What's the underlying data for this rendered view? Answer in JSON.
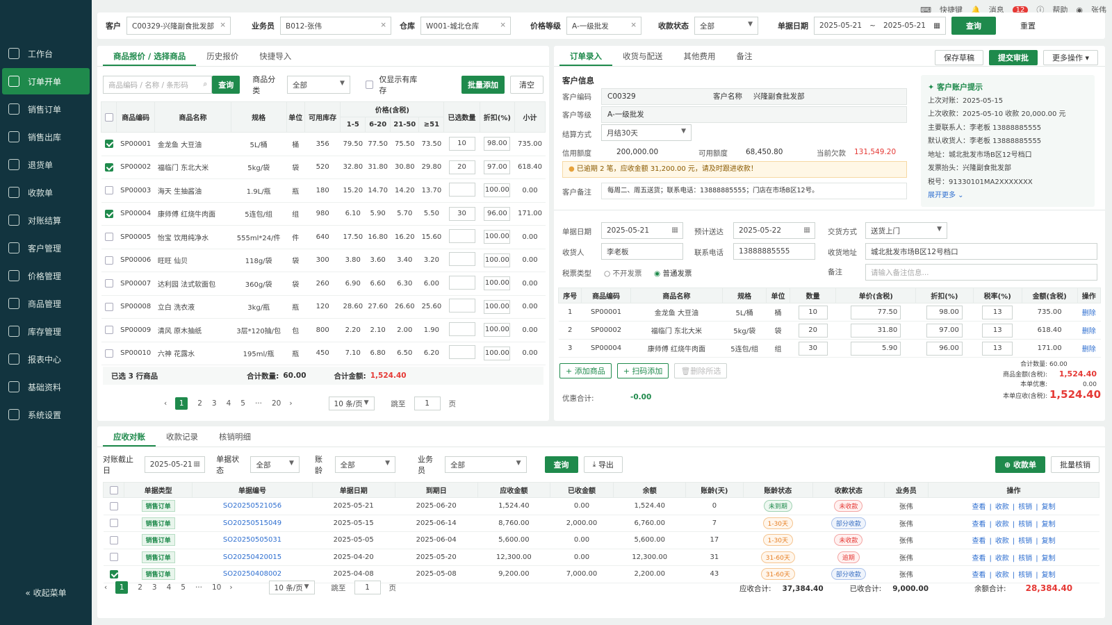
{
  "sidebar": {
    "items": [
      {
        "label": "工作台",
        "icon": "home-icon"
      },
      {
        "label": "订单开单",
        "icon": "order-icon"
      },
      {
        "label": "销售订单",
        "icon": "document-icon"
      },
      {
        "label": "销售出库",
        "icon": "outbound-icon"
      },
      {
        "label": "退货单",
        "icon": "return-icon"
      },
      {
        "label": "收款单",
        "icon": "coin-icon"
      },
      {
        "label": "对账结算",
        "icon": "reconcile-icon"
      },
      {
        "label": "客户管理",
        "icon": "user-icon"
      },
      {
        "label": "价格管理",
        "icon": "price-icon"
      },
      {
        "label": "商品管理",
        "icon": "goods-icon"
      },
      {
        "label": "库存管理",
        "icon": "warehouse-icon"
      },
      {
        "label": "报表中心",
        "icon": "chart-icon"
      },
      {
        "label": "基础资料",
        "icon": "database-icon"
      },
      {
        "label": "系统设置",
        "icon": "gear-icon"
      }
    ],
    "active": 1,
    "collapse": "收起菜单"
  },
  "topbar": {
    "shortcut": "快捷键",
    "message": "消息",
    "badge": "12",
    "help": "帮助",
    "user": "张伟"
  },
  "filters": {
    "customer_label": "客户",
    "customer": "C00329-兴隆副食批发部",
    "sales_label": "业务员",
    "sales": "B012-张伟",
    "wh_label": "仓库",
    "wh": "W001-城北仓库",
    "price_label": "价格等级",
    "price": "A-一级批发",
    "pay_label": "收款状态",
    "pay": "全部",
    "date_label": "单据日期",
    "date_from": "2025-05-21",
    "date_sep": "~",
    "date_to": "2025-05-21",
    "query": "查询",
    "reset": "重置"
  },
  "goods": {
    "tabs": [
      "商品报价 / 选择商品",
      "历史报价",
      "快捷导入"
    ],
    "search_placeholder": "商品编码 / 名称 / 条形码",
    "search_btn": "查询",
    "cat_label": "商品分类",
    "cat": "全部",
    "stock_only": "仅显示有库存",
    "batch_add": "批量添加",
    "clear": "清空",
    "headers": {
      "code": "商品编码",
      "name": "商品名称",
      "spec": "规格",
      "unit": "单位",
      "stock": "可用库存",
      "price_group": "价格(含税)",
      "p1": "1-5",
      "p2": "6-20",
      "p3": "21-50",
      "p4": "≥51",
      "qty": "已选数量",
      "disc": "折扣(%)",
      "sub": "小计"
    },
    "rows": [
      {
        "checked": true,
        "code": "SP00001",
        "name": "金龙鱼 大豆油",
        "spec": "5L/桶",
        "unit": "桶",
        "stock": "356",
        "p1": "79.50",
        "p2": "77.50",
        "p3": "75.50",
        "p4": "73.50",
        "qty": "10",
        "disc": "98.00",
        "sub": "735.00"
      },
      {
        "checked": true,
        "code": "SP00002",
        "name": "福临门 东北大米",
        "spec": "5kg/袋",
        "unit": "袋",
        "stock": "520",
        "p1": "32.80",
        "p2": "31.80",
        "p3": "30.80",
        "p4": "29.80",
        "qty": "20",
        "disc": "97.00",
        "sub": "618.40"
      },
      {
        "checked": false,
        "code": "SP00003",
        "name": "海天 生抽酱油",
        "spec": "1.9L/瓶",
        "unit": "瓶",
        "stock": "180",
        "p1": "15.20",
        "p2": "14.70",
        "p3": "14.20",
        "p4": "13.70",
        "qty": "",
        "disc": "100.00",
        "sub": "0.00"
      },
      {
        "checked": true,
        "code": "SP00004",
        "name": "康师傅 红烧牛肉面",
        "spec": "5连包/组",
        "unit": "组",
        "stock": "980",
        "p1": "6.10",
        "p2": "5.90",
        "p3": "5.70",
        "p4": "5.50",
        "qty": "30",
        "disc": "96.00",
        "sub": "171.00"
      },
      {
        "checked": false,
        "code": "SP00005",
        "name": "怡宝 饮用纯净水",
        "spec": "555ml*24/件",
        "unit": "件",
        "stock": "640",
        "p1": "17.50",
        "p2": "16.80",
        "p3": "16.20",
        "p4": "15.60",
        "qty": "",
        "disc": "100.00",
        "sub": "0.00"
      },
      {
        "checked": false,
        "code": "SP00006",
        "name": "旺旺 仙贝",
        "spec": "118g/袋",
        "unit": "袋",
        "stock": "300",
        "p1": "3.80",
        "p2": "3.60",
        "p3": "3.40",
        "p4": "3.20",
        "qty": "",
        "disc": "100.00",
        "sub": "0.00"
      },
      {
        "checked": false,
        "code": "SP00007",
        "name": "达利园 法式软面包",
        "spec": "360g/袋",
        "unit": "袋",
        "stock": "260",
        "p1": "6.90",
        "p2": "6.60",
        "p3": "6.30",
        "p4": "6.00",
        "qty": "",
        "disc": "100.00",
        "sub": "0.00"
      },
      {
        "checked": false,
        "code": "SP00008",
        "name": "立白 洗衣液",
        "spec": "3kg/瓶",
        "unit": "瓶",
        "stock": "120",
        "p1": "28.60",
        "p2": "27.60",
        "p3": "26.60",
        "p4": "25.60",
        "qty": "",
        "disc": "100.00",
        "sub": "0.00"
      },
      {
        "checked": false,
        "code": "SP00009",
        "name": "清风 原木抽纸",
        "spec": "3层*120抽/包",
        "unit": "包",
        "stock": "800",
        "p1": "2.20",
        "p2": "2.10",
        "p3": "2.00",
        "p4": "1.90",
        "qty": "",
        "disc": "100.00",
        "sub": "0.00"
      },
      {
        "checked": false,
        "code": "SP00010",
        "name": "六神 花露水",
        "spec": "195ml/瓶",
        "unit": "瓶",
        "stock": "450",
        "p1": "7.10",
        "p2": "6.80",
        "p3": "6.50",
        "p4": "6.20",
        "qty": "",
        "disc": "100.00",
        "sub": "0.00"
      }
    ],
    "footer_selected": "已选 3 行商品",
    "footer_qty_label": "合计数量:",
    "footer_qty": "60.00",
    "footer_amt_label": "合计金额:",
    "footer_amt": "1,524.40",
    "pager": {
      "pages": [
        "1",
        "2",
        "3",
        "4",
        "5",
        "···",
        "20"
      ],
      "size": "10 条/页",
      "jump": "跳至",
      "page": "1",
      "unit": "页"
    }
  },
  "order": {
    "tabs": [
      "订单录入",
      "收货与配送",
      "其他费用",
      "备注"
    ],
    "save": "保存草稿",
    "submit": "提交审批",
    "more": "更多操作",
    "section": "客户信息",
    "code_label": "客户编码",
    "code": "C00329",
    "name_label": "客户名称",
    "name": "兴隆副食批发部",
    "level_label": "客户等级",
    "level": "A-一级批发",
    "settle_label": "结算方式",
    "settle": "月结30天",
    "credit_label": "信用额度",
    "credit": "200,000.00",
    "avail_label": "可用额度",
    "avail": "68,450.80",
    "debt_label": "当前欠款",
    "debt": "131,549.20",
    "warning": "已逾期 2 笔，应收金额 31,200.00 元，请及时跟进收款！",
    "remark_label": "客户备注",
    "remark": "每周二、周五送货；联系电话：13888885555；门店在市场B区12号。",
    "tip": {
      "title": "客户账户提示",
      "lines": [
        "上次对账：2025-05-15",
        "上次收款：2025-05-10 收款 20,000.00 元",
        "主要联系人：李老板 13888885555",
        "默认收货人：李老板 13888885555",
        "地址：城北批发市场B区12号档口",
        "发票抬头：兴隆副食批发部",
        "税号：91330101MA2XXXXXXX"
      ],
      "more": "展开更多"
    },
    "date_label": "单据日期",
    "date": "2025-05-21",
    "deliver_label": "预计送达",
    "deliver": "2025-05-22",
    "trade_label": "交货方式",
    "trade": "送货上门",
    "receiver_label": "收货人",
    "receiver": "李老板",
    "phone_label": "联系电话",
    "phone": "13888885555",
    "addr_label": "收货地址",
    "addr": "城北批发市场B区12号档口",
    "tax_label": "税票类型",
    "tax_opt1": "不开发票",
    "tax_opt2": "普通发票",
    "memo_label": "备注",
    "memo_placeholder": "请输入备注信息...",
    "headers": {
      "no": "序号",
      "code": "商品编码",
      "name": "商品名称",
      "spec": "规格",
      "unit": "单位",
      "qty": "数量",
      "price": "单价(含税)",
      "disc": "折扣(%)",
      "tax": "税率(%)",
      "amt": "金额(含税)",
      "op": "操作"
    },
    "rows": [
      {
        "no": "1",
        "code": "SP00001",
        "name": "金龙鱼 大豆油",
        "spec": "5L/桶",
        "unit": "桶",
        "qty": "10",
        "price": "77.50",
        "disc": "98.00",
        "tax": "13",
        "amt": "735.00",
        "op": "删除"
      },
      {
        "no": "2",
        "code": "SP00002",
        "name": "福临门 东北大米",
        "spec": "5kg/袋",
        "unit": "袋",
        "qty": "20",
        "price": "31.80",
        "disc": "97.00",
        "tax": "13",
        "amt": "618.40",
        "op": "删除"
      },
      {
        "no": "3",
        "code": "SP00004",
        "name": "康师傅 红烧牛肉面",
        "spec": "5连包/组",
        "unit": "组",
        "qty": "30",
        "price": "5.90",
        "disc": "96.00",
        "tax": "13",
        "amt": "171.00",
        "op": "删除"
      }
    ],
    "add_goods": "+ 添加商品",
    "scan_add": "+ 扫码添加",
    "del_selected": "删除所选",
    "sum_qty_label": "合计数量:",
    "sum_qty": "60.00",
    "goods_amt_label": "商品金额(含税):",
    "goods_amt": "1,524.40",
    "discount_label": "本单优惠:",
    "discount": "0.00",
    "payable_label": "本单应收(含税):",
    "payable": "1,524.40",
    "promo_label": "优惠合计:",
    "promo": "-0.00"
  },
  "recv": {
    "tabs": [
      "应收对账",
      "收款记录",
      "核销明细"
    ],
    "cutoff_label": "对账截止日",
    "cutoff": "2025-05-21",
    "status_label": "单据状态",
    "status": "全部",
    "age_label": "账龄",
    "age": "全部",
    "sales_label": "业务员",
    "sales": "全部",
    "query": "查询",
    "export": "导出",
    "receipt": "收款单",
    "batch": "批量核销",
    "headers": {
      "type": "单据类型",
      "no": "单据编号",
      "date": "单据日期",
      "due": "到期日",
      "recv": "应收金额",
      "paid": "已收金额",
      "bal": "余额",
      "days": "账龄(天)",
      "age": "账龄状态",
      "pay": "收款状态",
      "sales": "业务员",
      "op": "操作"
    },
    "rows": [
      {
        "checked": false,
        "type": "销售订单",
        "no": "SO20250521056",
        "date": "2025-05-21",
        "due": "2025-06-20",
        "recv": "1,524.40",
        "paid": "0.00",
        "bal": "1,524.40",
        "days": "0",
        "age": "未到期",
        "age_c": "gr",
        "pay": "未收款",
        "pay_c": "rd",
        "sales": "张伟"
      },
      {
        "checked": false,
        "type": "销售订单",
        "no": "SO20250515049",
        "date": "2025-05-15",
        "due": "2025-06-14",
        "recv": "8,760.00",
        "paid": "2,000.00",
        "bal": "6,760.00",
        "days": "7",
        "age": "1-30天",
        "age_c": "or",
        "pay": "部分收款",
        "pay_c": "bl",
        "sales": "张伟"
      },
      {
        "checked": false,
        "type": "销售订单",
        "no": "SO20250505031",
        "date": "2025-05-05",
        "due": "2025-06-04",
        "recv": "5,600.00",
        "paid": "0.00",
        "bal": "5,600.00",
        "days": "17",
        "age": "1-30天",
        "age_c": "or",
        "pay": "未收款",
        "pay_c": "rd",
        "sales": "张伟"
      },
      {
        "checked": false,
        "type": "销售订单",
        "no": "SO20250420015",
        "date": "2025-04-20",
        "due": "2025-05-20",
        "recv": "12,300.00",
        "paid": "0.00",
        "bal": "12,300.00",
        "days": "31",
        "age": "31-60天",
        "age_c": "or",
        "pay": "逾期",
        "pay_c": "rd",
        "sales": "张伟"
      },
      {
        "checked": true,
        "type": "销售订单",
        "no": "SO20250408002",
        "date": "2025-04-08",
        "due": "2025-05-08",
        "recv": "9,200.00",
        "paid": "7,000.00",
        "bal": "2,200.00",
        "days": "43",
        "age": "31-60天",
        "age_c": "or",
        "pay": "部分收款",
        "pay_c": "bl",
        "sales": "张伟"
      }
    ],
    "ops": [
      "查看",
      "收款",
      "核销",
      "复制"
    ],
    "sep": "|",
    "pager": {
      "pages": [
        "1",
        "2",
        "3",
        "4",
        "5",
        "···",
        "10"
      ],
      "size": "10 条/页",
      "jump": "跳至",
      "page": "1",
      "unit": "页"
    },
    "total_recv_label": "应收合计:",
    "total_recv": "37,384.40",
    "total_paid_label": "已收合计:",
    "total_paid": "9,000.00",
    "total_bal_label": "余额合计:",
    "total_bal": "28,384.40"
  }
}
